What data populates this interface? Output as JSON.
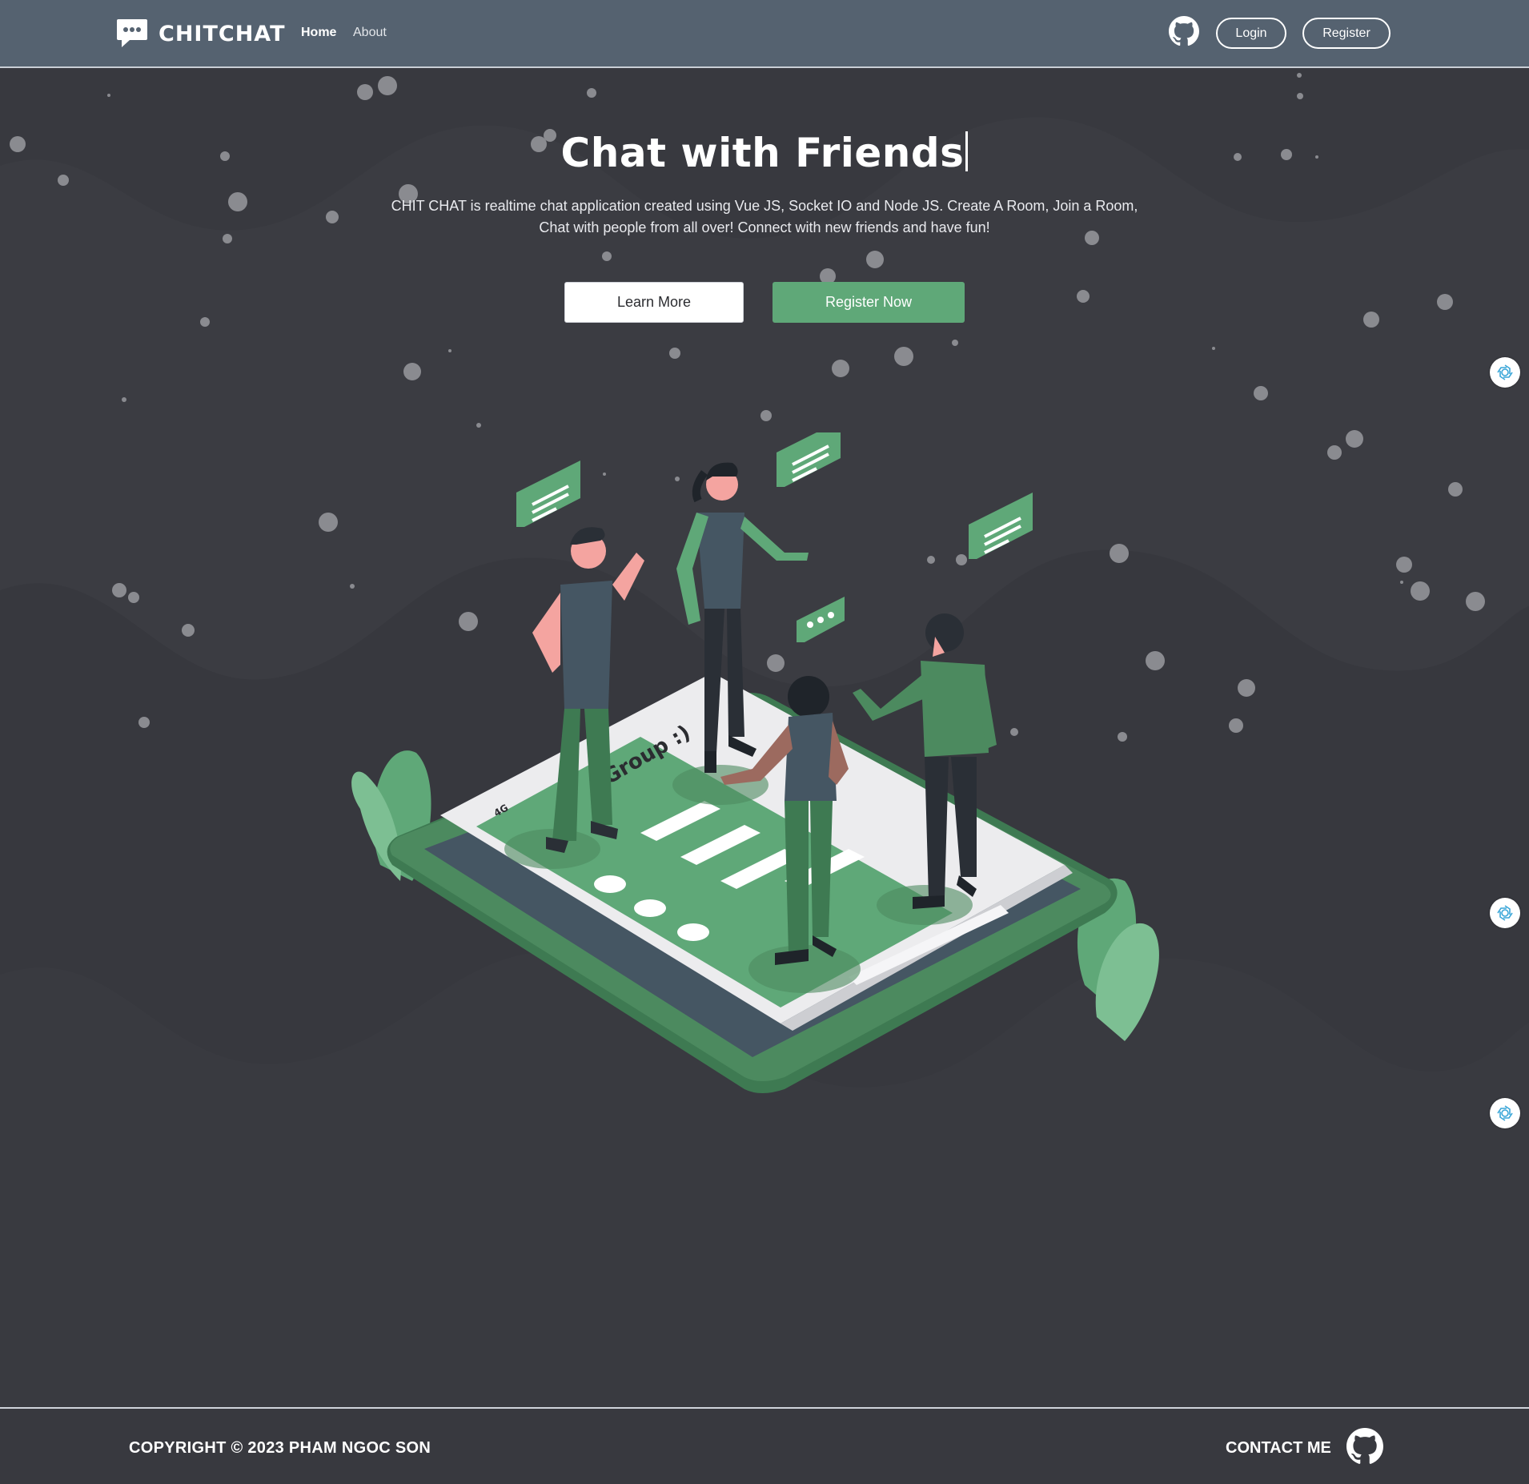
{
  "navbar": {
    "brand": "CHITCHAT",
    "links": {
      "home": "Home",
      "about": "About"
    },
    "login_label": "Login",
    "register_label": "Register"
  },
  "hero": {
    "title": "Chat with Friends",
    "description": "CHIT CHAT is realtime chat application created using Vue JS, Socket IO and Node JS. Create A Room, Join a Room, Chat with people from all over! Connect with new friends and have fun!",
    "learn_more_label": "Learn More",
    "register_now_label": "Register Now"
  },
  "illustration": {
    "screen_header": "Group :)",
    "network": "4G"
  },
  "footer": {
    "copyright": "COPYRIGHT © 2023 PHAM NGOC SON",
    "contact": "CONTACT ME"
  },
  "colors": {
    "navbar_bg": "#556270",
    "page_bg": "#38393f",
    "accent_green": "#5fa878",
    "dark_green": "#3e7a52"
  },
  "icons": {
    "brand": "chat-bubble-icon",
    "github": "github-icon",
    "side_extension": "openai-icon"
  }
}
